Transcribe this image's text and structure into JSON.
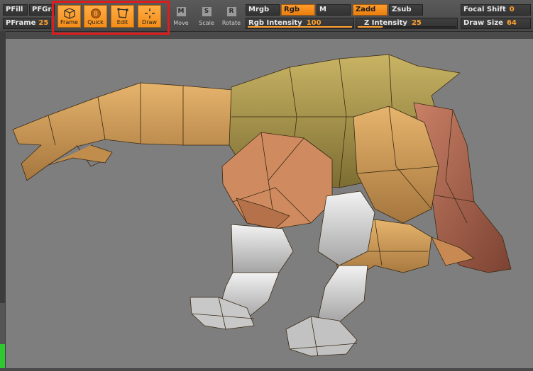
{
  "toolbar": {
    "pfill": "PFill",
    "pfgra": "PFGra",
    "pframe": {
      "label": "PFrame",
      "value": "25"
    },
    "mrgb": "Mrgb",
    "rgb": "Rgb",
    "m": "M",
    "zadd": "Zadd",
    "zsub": "Zsub",
    "focal_shift": {
      "label": "Focal Shift",
      "value": "0"
    },
    "rgb_intensity": {
      "label": "Rgb Intensity",
      "value": "100",
      "level": 1.0
    },
    "z_intensity": {
      "label": "Z Intensity",
      "value": "25",
      "level": 0.25
    },
    "draw_size": {
      "label": "Draw Size",
      "value": "64"
    }
  },
  "modes": [
    {
      "label": "Frame",
      "icon": "cube-frame-icon"
    },
    {
      "label": "Quick",
      "icon": "sphere-quick-icon"
    },
    {
      "label": "Edit",
      "icon": "edit-frame-icon"
    },
    {
      "label": "Draw",
      "icon": "crosshair-draw-icon"
    }
  ],
  "transforms": [
    {
      "key": "M",
      "label": "Move"
    },
    {
      "key": "S",
      "label": "Scale"
    },
    {
      "key": "R",
      "label": "Rotate"
    }
  ],
  "colors": {
    "accent": "#f48d19",
    "highlight": "#e01b1b",
    "canvas": "#7e7e7e"
  }
}
